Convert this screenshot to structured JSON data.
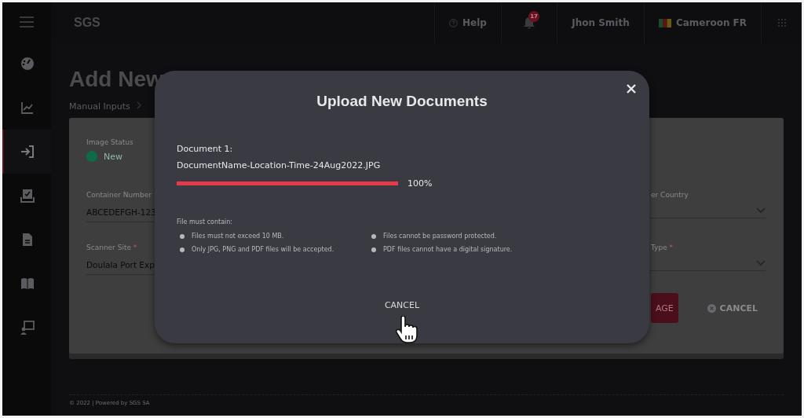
{
  "topbar": {
    "logo": "SGS",
    "help": "Help",
    "notifications": "17",
    "user": "Jhon Smith",
    "country": "Cameroon FR"
  },
  "sidebar": {
    "items": [
      {
        "kind": "gauge",
        "selected": false
      },
      {
        "kind": "chart",
        "selected": false
      },
      {
        "kind": "login",
        "selected": true
      },
      {
        "kind": "tray",
        "selected": false
      },
      {
        "kind": "document",
        "selected": false
      },
      {
        "kind": "book",
        "selected": false
      },
      {
        "kind": "presenter",
        "selected": false
      }
    ]
  },
  "page": {
    "title": "Add New",
    "breadcrumb": [
      "Manual Inputs"
    ]
  },
  "form": {
    "left": [
      {
        "kind": "status",
        "label": "Image Status",
        "value": "New",
        "color": "#0e6b45"
      },
      {
        "kind": "text",
        "label": "Container Number",
        "value": "ABCEDEFGH-123"
      },
      {
        "kind": "text",
        "label": "Scanner Site",
        "required": "*",
        "value": "Doulala Port Exp"
      }
    ],
    "right": [
      {
        "kind": "select",
        "label": "er Country"
      },
      {
        "kind": "select",
        "label": "Type",
        "required": "*"
      }
    ],
    "buttons": [
      {
        "kind": "primary",
        "label": "AGE"
      },
      {
        "kind": "cancel",
        "label": "CANCEL"
      }
    ]
  },
  "footer": "© 2022 | Powered by SGS SA",
  "dialog": {
    "title": "Upload New Documents",
    "document_label": "Document 1:",
    "file_name": "DocumentName-Location-Time-24Aug2022.JPG",
    "level": 1,
    "percent": "100%",
    "rules_title": "File must contain:",
    "rules": [
      "Files must not exceed 10 MB.",
      "Files cannot be password protected.",
      "Only JPG, PNG and PDF files will be accepted.",
      "PDF files cannot have a digital signature."
    ],
    "cancel": "CANCEL"
  }
}
